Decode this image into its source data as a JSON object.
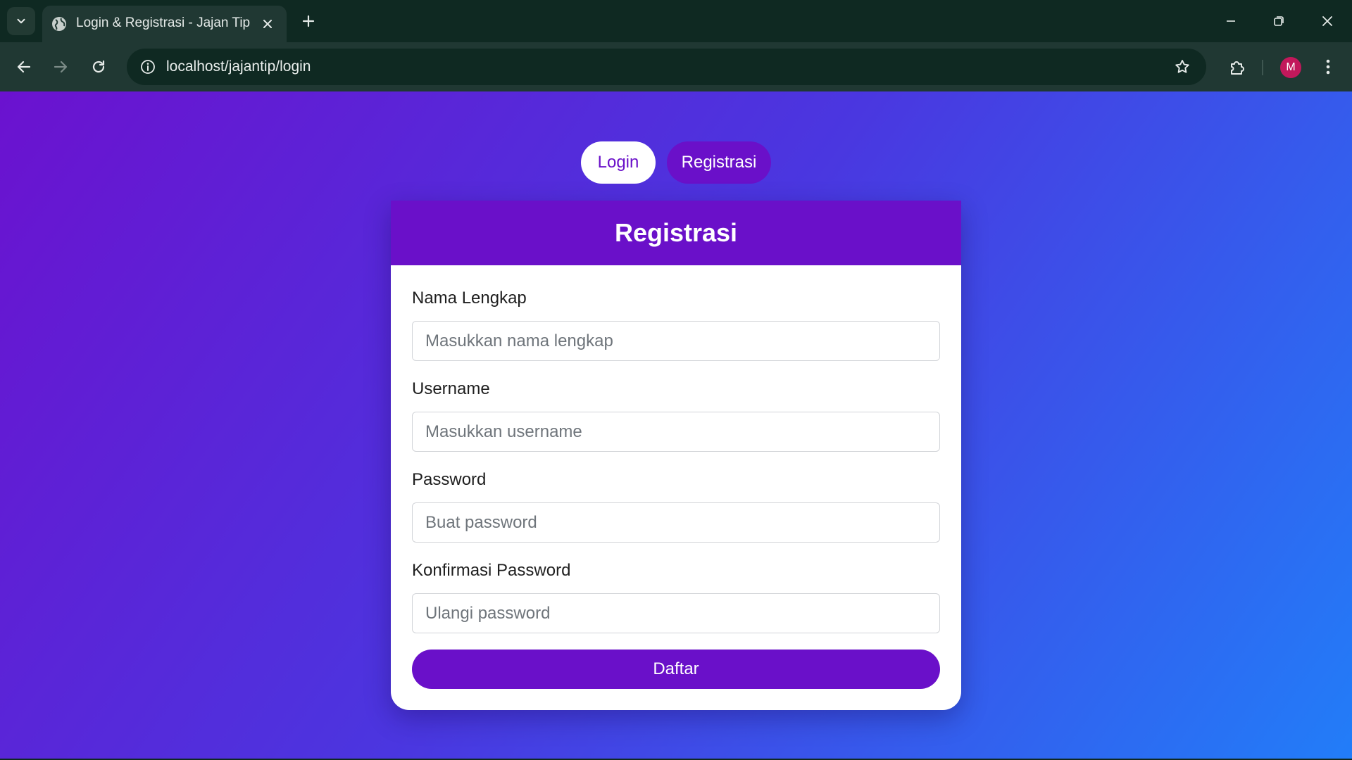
{
  "browser": {
    "tab_title": "Login & Registrasi - Jajan Tip",
    "url": "localhost/jajantip/login",
    "profile_initial": "M",
    "icons": {
      "tab_search": "chevron-down-icon",
      "favicon": "globe-icon",
      "tab_close": "close-icon",
      "new_tab": "plus-icon",
      "minimize": "minimize-icon",
      "restore": "restore-icon",
      "close_window": "close-icon",
      "back": "arrow-left-icon",
      "forward": "arrow-right-icon",
      "reload": "reload-icon",
      "site_info": "info-icon",
      "bookmark": "star-icon",
      "extensions": "puzzle-icon",
      "menu": "kebab-menu-icon"
    }
  },
  "toggle": {
    "login_label": "Login",
    "register_label": "Registrasi",
    "active": "Registrasi"
  },
  "form": {
    "title": "Registrasi",
    "fields": [
      {
        "label": "Nama Lengkap",
        "placeholder": "Masukkan nama lengkap",
        "value": ""
      },
      {
        "label": "Username",
        "placeholder": "Masukkan username",
        "value": ""
      },
      {
        "label": "Password",
        "placeholder": "Buat password",
        "value": ""
      },
      {
        "label": "Konfirmasi Password",
        "placeholder": "Ulangi password",
        "value": ""
      }
    ],
    "submit_label": "Daftar"
  },
  "colors": {
    "accent": "#6a10c9",
    "gradient_start": "#6b12cf",
    "gradient_end": "#227df8",
    "chrome_dark": "#0f2922",
    "chrome_toolbar": "#203833",
    "avatar": "#c2185b"
  }
}
